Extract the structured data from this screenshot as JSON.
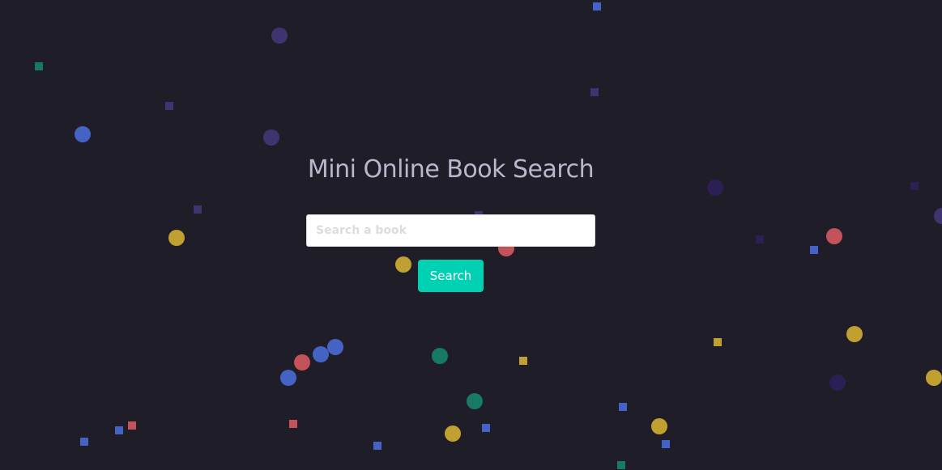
{
  "header": {
    "title": "Mini Online Book Search"
  },
  "search": {
    "placeholder": "Search a book",
    "value": "",
    "button_label": "Search"
  },
  "colors": {
    "background": "#1f1e28",
    "accent": "#00d1b2",
    "blue": "#4463c4",
    "purple": "#3f3470",
    "yellow": "#c0a030",
    "red": "#c4525a",
    "teal": "#167a64",
    "indigo": "#2b1f55"
  }
}
